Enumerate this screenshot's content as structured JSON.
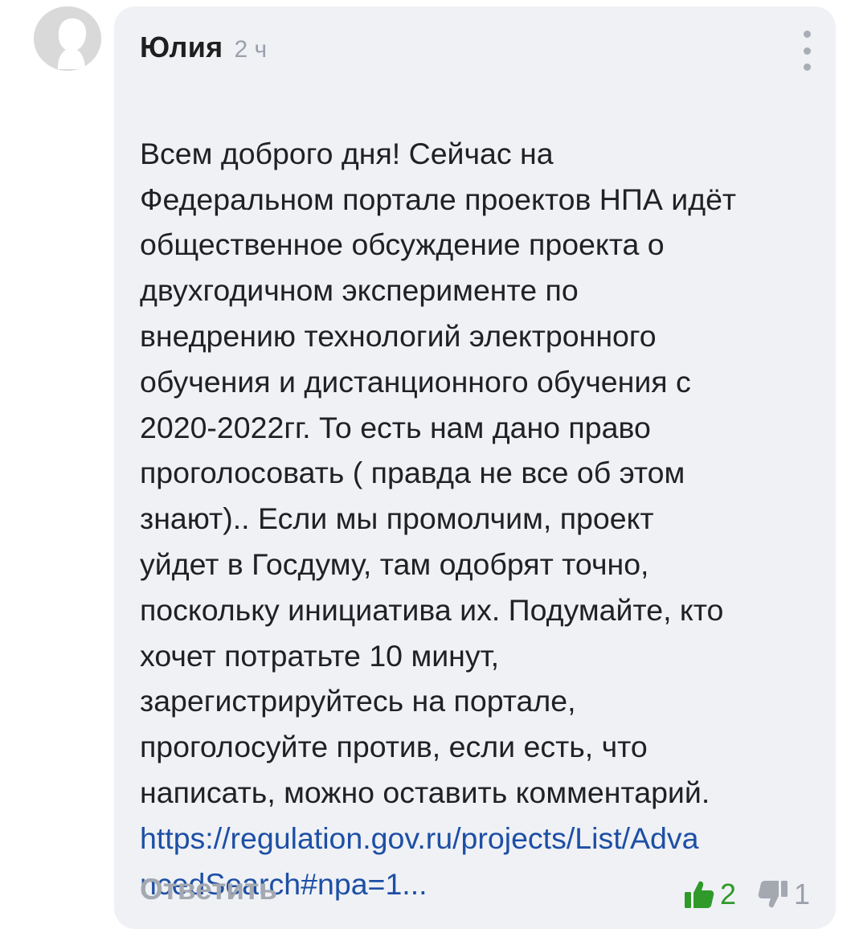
{
  "comment": {
    "author": "Юлия",
    "time": "2 ч",
    "text": "Всем доброго дня! Сейчас на\nФедеральном портале проектов НПА идёт\nобщественное обсуждение проекта о\nдвухгодичном эксперименте по\nвнедрению технологий электронного\nобучения и дистанционного обучения с\n2020-2022гг. То есть нам дано право\nпроголосовать ( правда не все об этом\nзнают).. Если мы промолчим, проект\nуйдет в Госдуму, там одобрят точно,\nпоскольку инициатива их. Подумайте, кто\nхочет потратьте 10 минут,\nзарегистрируйтесь на портале,\nпроголосуйте против, если есть, что\nнаписать, можно оставить комментарий.",
    "link_text": "https://regulation.gov.ru/projects/List/Adva\nncedSearch#npa=1...",
    "reply_label": "Ответить",
    "likes": "2",
    "dislikes": "1"
  },
  "icons": {
    "avatar": "default-user-avatar",
    "menu": "more-vertical-icon",
    "like": "thumbs-up-icon",
    "dislike": "thumbs-down-icon"
  },
  "colors": {
    "bubble_bg": "#eff1f5",
    "link": "#1d4fa5",
    "like": "#2f9a2a",
    "muted": "#a3a8b1"
  }
}
